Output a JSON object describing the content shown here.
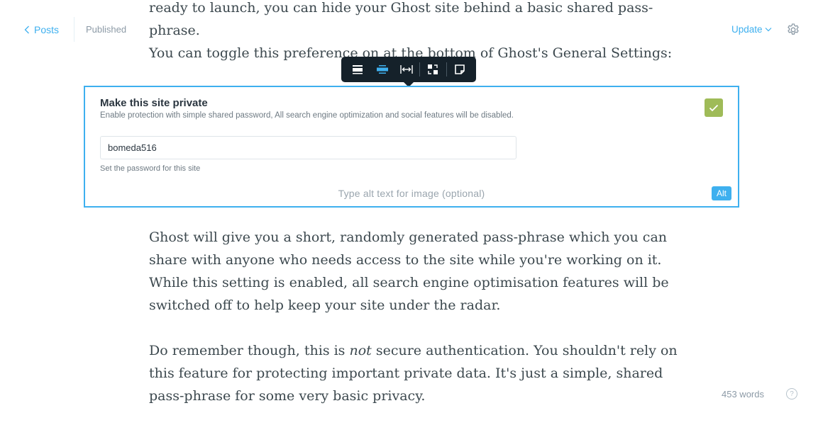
{
  "header": {
    "back_label": "Posts",
    "status": "Published",
    "update_label": "Update"
  },
  "editor": {
    "p1": "ready to launch, you can hide your Ghost site behind a basic shared pass-phrase.",
    "p2": "You can toggle this preference on at the bottom of Ghost's General Settings:",
    "p3": "Ghost will give you a short, randomly generated pass-phrase which you can share with anyone who needs access to the site while you're working on it. While this setting is enabled, all search engine optimisation features will be switched off to help keep your site under the radar.",
    "p4_before": "Do remember though, this is ",
    "p4_em": "not",
    "p4_after": " secure authentication. You shouldn't rely on this feature for protecting important private data. It's just a simple, shared pass-phrase for some very basic privacy."
  },
  "card_toolbar": {
    "buttons": [
      "image-width-regular-icon",
      "image-width-wide-icon",
      "image-width-full-icon",
      "replace-image-icon",
      "snippet-icon"
    ],
    "active_index": 1
  },
  "image_card": {
    "title": "Make this site private",
    "description": "Enable protection with simple shared password, All search engine optimization and social features will be disabled.",
    "password_value": "bomeda516",
    "hint": "Set the password for this site",
    "checked": true,
    "alt_placeholder": "Type alt text for image (optional)",
    "alt_button": "Alt"
  },
  "footer": {
    "word_count": "453 words",
    "help_label": "?"
  },
  "colors": {
    "accent": "#3eb0ef",
    "toolbar_bg": "#15212a",
    "check_green": "#9fbb58"
  }
}
